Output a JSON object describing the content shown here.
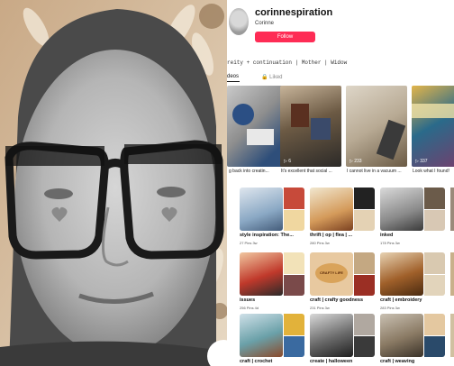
{
  "profile": {
    "handle": "corinnespiration",
    "name": "Corinne",
    "follow_label": "Follow",
    "bio": "reity + continuation | Mother | Widow"
  },
  "tabs": {
    "videos": "deos",
    "liked": "Liked"
  },
  "videos": [
    {
      "count": "",
      "caption": "g back into creatin..."
    },
    {
      "count": "6",
      "caption": "It's excellent that social ..."
    },
    {
      "count": "233",
      "caption": "I cannot live in a vacuum ..."
    },
    {
      "count": "337",
      "caption": "Look what I found!"
    }
  ],
  "boards_row1": [
    {
      "title": "style inspiration: The...",
      "meta": "27 Pins  3w"
    },
    {
      "title": "thrift | op | flea | ...",
      "meta": "280 Pins  3w"
    },
    {
      "title": "inked",
      "meta": "178 Pins  3w"
    }
  ],
  "boards_row2": [
    {
      "title": "issues",
      "meta": "256 Pins  4d"
    },
    {
      "title": "craft | crafty goodness",
      "meta": "231 Pins  3w"
    },
    {
      "title": "craft | embroidery",
      "meta": "283 Pins  3w"
    }
  ],
  "boards_row3": [
    {
      "title": "craft | crochet",
      "meta": ""
    },
    {
      "title": "create | halloween",
      "meta": ""
    },
    {
      "title": "craft | weaving",
      "meta": ""
    }
  ],
  "board_overlays": {
    "crafty_sign": "CRAFTY LIFE"
  },
  "colors": {
    "follow": "#fe2c55"
  }
}
